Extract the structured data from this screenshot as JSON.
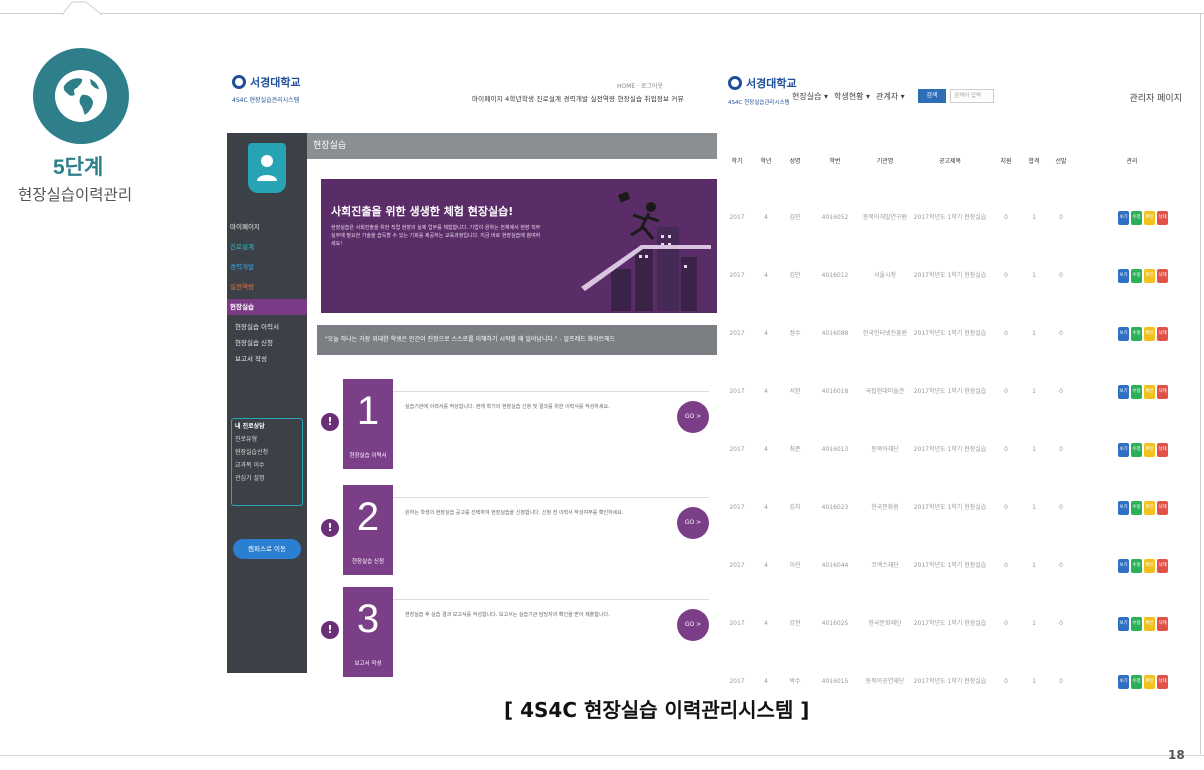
{
  "step": {
    "title": "5단계",
    "subtitle": "현장실습이력관리"
  },
  "caption": "[ 4S4C 현장실습 이력관리시스템 ]",
  "page_number": "18",
  "left_screen": {
    "logo": "서경대학교",
    "logo_sub": "4S4C 현장실습관리시스템",
    "topnav_small": "HOME · 로그아웃",
    "topnav": "마이페이지 4학년학생 진로설계 경력개발 실전역량 현장실습 취업정보 커뮤",
    "sidebar_items": [
      "마이페이지",
      "진로설계",
      "경력개발",
      "실전역량",
      "현장실습",
      "현장실습 이력서",
      "현장실습 신청",
      "보고서 작성"
    ],
    "sidebar_box": [
      "내 진로상담",
      "진로유형",
      "현장실습신청",
      "교과목 이수",
      "관심기 설정"
    ],
    "sidebar_button": "캠퍼스로 이동",
    "content_title": "현장실습",
    "banner_title": "사회진출을 위한 생생한 체험 현장실습!",
    "banner_text": "현장실습은 사회진출을 위한 직업 현장의 실제 업무를 체험합니다. 기업이 원하는 전체에서 현장 직무 실무에 필요한 기술을 습득할 수 있는 기회를 제공하는 교육과정입니다. 지금 바로 현장실습에 참여하세요!",
    "quote": "\"오늘 하나는 가장 위대한 학생은 인간이 진정으로 스스로를 이해하기 시작할 때 일어납니다.\" - 알프레드 화이트헤드",
    "steps": [
      {
        "num": "1",
        "label": "현장실습 이력서",
        "desc": "실습기관에 이력서를 작성합니다. 현재 학기의 현장실습 신청 및 결과를 위한 이력서를 작성하세요.",
        "go": "GO >"
      },
      {
        "num": "2",
        "label": "현장실습 신청",
        "desc": "원하는 학생의 현장실습 공고를 선택하여 현장실습을 신청합니다. 신청 전 이력서 작성여부를 확인하세요.",
        "go": "GO >"
      },
      {
        "num": "3",
        "label": "보고서 작성",
        "desc": "현장실습 후 실습 결과 보고서를 작성합니다. 보고서는 실습기관 담당자의 확인을 받아 제출합니다.",
        "go": "GO >"
      }
    ]
  },
  "right_screen": {
    "logo": "서경대학교",
    "logo_sub": "4S4C 현장실습관리시스템",
    "menus": [
      "현장실습 ▾",
      "학생현황 ▾",
      "관계자 ▾"
    ],
    "search_button": "검색",
    "search_placeholder": "검색어 입력",
    "admin": "관리자 페이지",
    "columns": [
      "학기",
      "학년",
      "성명",
      "학번",
      "기관명",
      "공고제목",
      "지원",
      "합격",
      "선발",
      "관리"
    ],
    "rows": [
      [
        "2017",
        "4",
        "김민",
        "4016052",
        "동북아개발연구원",
        "2017학년도 1학기 현장실습",
        "0",
        "1",
        "0"
      ],
      [
        "2017",
        "4",
        "김민",
        "4016012",
        "서울시청",
        "2017학년도 1학기 현장실습",
        "0",
        "1",
        "0"
      ],
      [
        "2017",
        "4",
        "정수",
        "4016088",
        "한국인터넷진흥원",
        "2017학년도 1학기 현장실습",
        "0",
        "1",
        "0"
      ],
      [
        "2017",
        "4",
        "서현",
        "4016018",
        "국립현대미술관",
        "2017학년도 1학기 현장실습",
        "0",
        "1",
        "0"
      ],
      [
        "2017",
        "4",
        "최준",
        "4016013",
        "동북아재단",
        "2017학년도 1학기 현장실습",
        "0",
        "1",
        "0"
      ],
      [
        "2017",
        "4",
        "김지",
        "4016023",
        "한국문화원",
        "2017학년도 1학기 현장실습",
        "0",
        "1",
        "0"
      ],
      [
        "2017",
        "4",
        "이진",
        "4016044",
        "코엑스재단",
        "2017학년도 1학기 현장실습",
        "0",
        "1",
        "0"
      ],
      [
        "2017",
        "4",
        "강현",
        "4016025",
        "한국문화재단",
        "2017학년도 1학기 현장실습",
        "0",
        "1",
        "0"
      ],
      [
        "2017",
        "4",
        "박수",
        "4016015",
        "동북아공연재단",
        "2017학년도 1학기 현장실습",
        "0",
        "1",
        "0"
      ]
    ],
    "actions": [
      {
        "label": "보기",
        "color": "#2f6fc4"
      },
      {
        "label": "수정",
        "color": "#2bb05a"
      },
      {
        "label": "확인",
        "color": "#f2c21a"
      },
      {
        "label": "삭제",
        "color": "#e2504a"
      }
    ]
  }
}
